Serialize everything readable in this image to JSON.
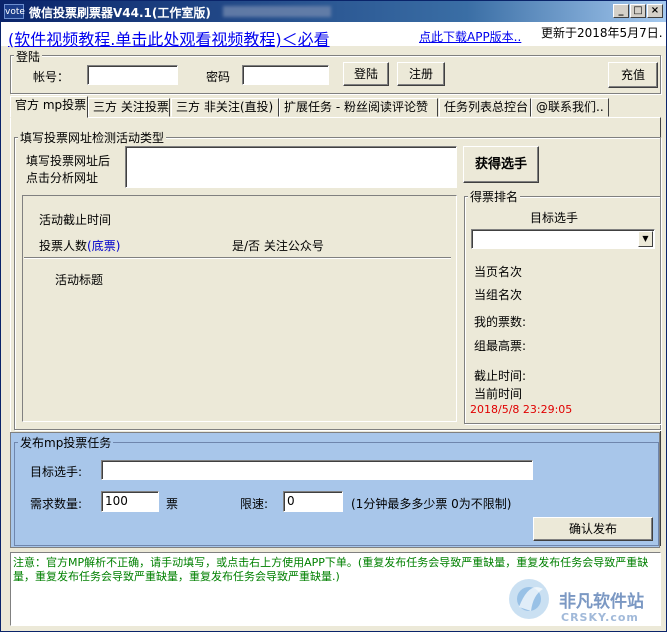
{
  "window": {
    "title": "微信投票刷票器V44.1(工作室版)",
    "icon_text": "vote",
    "buttons": {
      "minimize": "_",
      "maximize": "□",
      "close": "×"
    }
  },
  "top": {
    "tutorial_link": "(软件视频教程.单击此处观看视频教程)＜必看",
    "app_link": "点此下载APP版本..",
    "updated": "更新于2018年5月7日."
  },
  "login": {
    "group_label": "登陆",
    "account_label": "帐号：",
    "account_value": "",
    "password_label": "密码",
    "password_value": "",
    "login_button": "登陆",
    "register_button": "注册",
    "recharge_button": "充值"
  },
  "tabs": [
    {
      "label": "官方 mp投票"
    },
    {
      "label": "三方 关注投票"
    },
    {
      "label": "三方 非关注(直投)"
    },
    {
      "label": "扩展任务 - 粉丝阅读评论赞"
    },
    {
      "label": "任务列表总控台"
    },
    {
      "label": "@联系我们.."
    }
  ],
  "detect": {
    "group_label": "填写投票网址检测活动类型",
    "url_hint_line1": "填写投票网址后",
    "url_hint_line2": "点击分析网址",
    "url_value": "",
    "get_candidate_button": "获得选手",
    "deadline_label": "活动截止时间",
    "voters_label": "投票人数",
    "voters_suffix": "(底票)",
    "follow_label": "是/否 关注公众号",
    "activity_title_label": "活动标题"
  },
  "ranking": {
    "group_label": "得票排名",
    "target_label": "目标选手",
    "target_value": "",
    "page_rank": "当页名次",
    "group_rank": "当组名次",
    "my_votes": "我的票数:",
    "group_max": "组最高票:",
    "deadline": "截止时间:",
    "current_time_label": "当前时间",
    "current_time_value": "2018/5/8 23:29:05"
  },
  "publish": {
    "group_label": "发布mp投票任务",
    "target_label": "目标选手:",
    "target_value": "",
    "qty_label": "需求数量:",
    "qty_value": "100",
    "qty_unit": "票",
    "speed_label": "限速:",
    "speed_value": "0",
    "speed_hint": "(1分钟最多多少票 0为不限制)",
    "confirm_button": "确认发布"
  },
  "notes": {
    "text": "注意：官方MP解析不正确，请手动填写，或点击右上方使用APP下单。(重复发布任务会导致严重缺量，重复发布任务会导致严重缺量，重复发布任务会导致严重缺量，重复发布任务会导致严重缺量.)"
  },
  "watermark": {
    "cn": "非凡软件站",
    "en": "CRSKY.com"
  },
  "colors": {
    "title_bar": "#0a246a",
    "link": "#0000ee",
    "publish_panel": "#a8c6ea",
    "notes_text": "#008000",
    "time_red": "#e00000"
  }
}
